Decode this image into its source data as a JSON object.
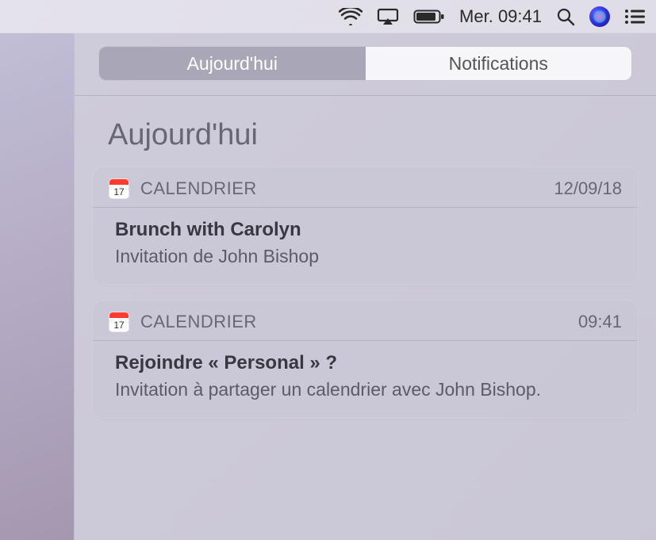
{
  "menubar": {
    "datetime": "Mer. 09:41"
  },
  "segmented": {
    "today": "Aujourd'hui",
    "notifications": "Notifications"
  },
  "heading": "Aujourd'hui",
  "cards": [
    {
      "app": "CALENDRIER",
      "icon_day": "17",
      "time": "12/09/18",
      "title": "Brunch with Carolyn",
      "subtitle": "Invitation de John Bishop"
    },
    {
      "app": "CALENDRIER",
      "icon_day": "17",
      "time": "09:41",
      "title": "Rejoindre « Personal » ?",
      "subtitle": "Invitation à partager un calendrier avec John Bishop."
    }
  ]
}
